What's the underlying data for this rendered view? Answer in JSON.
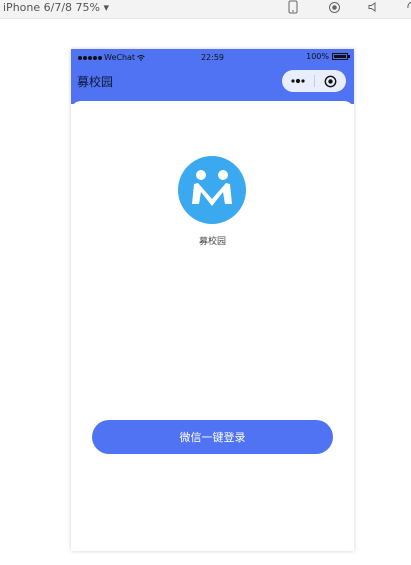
{
  "devtools": {
    "device_label": "iPhone 6/7/8 75% ▾",
    "icons": [
      "phone-outline-icon",
      "record-icon",
      "speaker-icon",
      "rotate-icon"
    ]
  },
  "status_bar": {
    "carrier": "WeChat",
    "time": "22:59",
    "battery": "100%",
    "battery_level": 1.0
  },
  "nav": {
    "title": "募校园",
    "menu_icon": "more-dots-icon",
    "close_icon": "target-close-icon"
  },
  "page": {
    "app_name": "募校园",
    "login_button": "微信一键登录"
  },
  "colors": {
    "primary": "#4f73f3",
    "logo_bg": "#3aa9ef",
    "background": "#ffffff"
  }
}
